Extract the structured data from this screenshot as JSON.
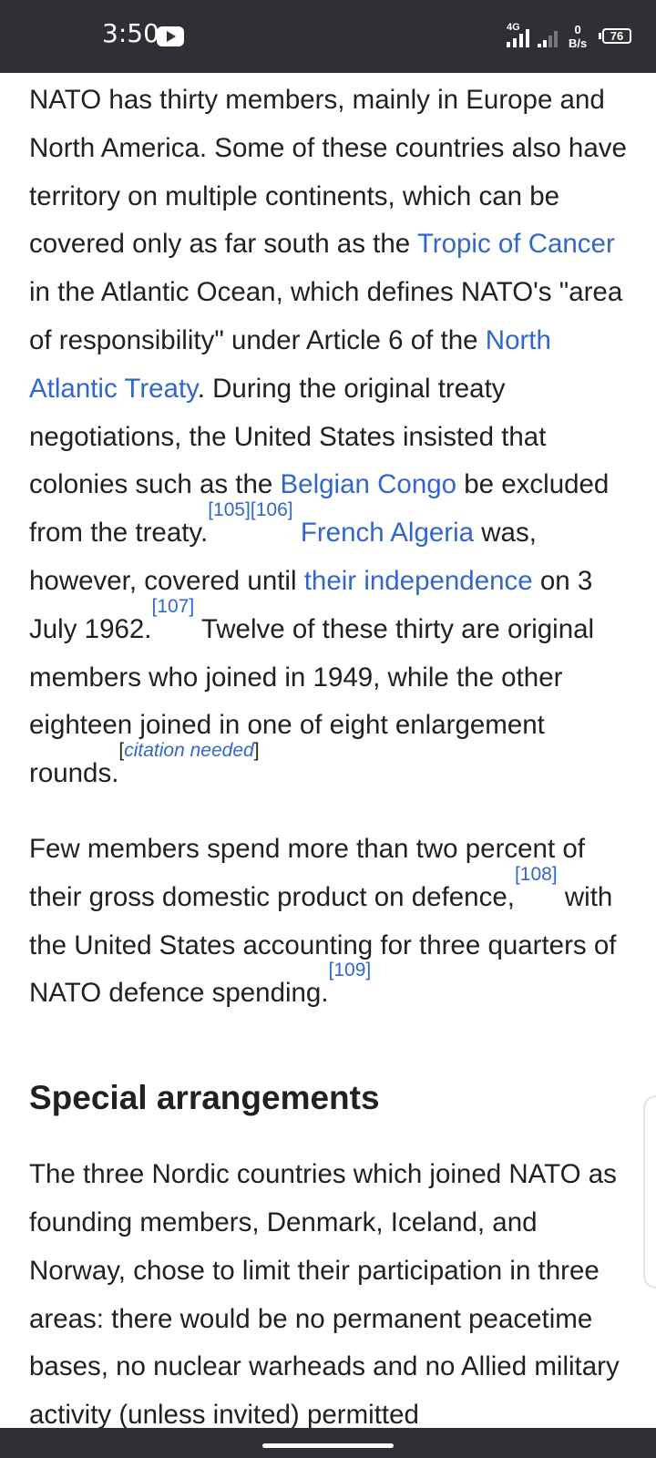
{
  "status_bar": {
    "time": "3:50",
    "network": "4G",
    "speed_value": "0",
    "speed_unit": "B/s",
    "battery": "76"
  },
  "article": {
    "p1": {
      "t1": "NATO has thirty members, mainly in Europe and North America. Some of these countries also have territory on multiple continents, which can be covered only as far south as the ",
      "link_tropic": "Tropic of Cancer",
      "t2": " in the Atlantic Ocean, which defines NATO's \"area of responsibility\" under Article 6 of the ",
      "link_treaty": "North Atlantic Treaty",
      "t3": ". During the original treaty negotiations, the United States insisted that colonies such as the ",
      "link_congo": "Belgian Congo",
      "t4": " be excluded from the treaty.",
      "ref_105": "[105]",
      "ref_106": "[106]",
      "t5": " ",
      "link_algeria": "French Algeria",
      "t6": " was, however, covered until ",
      "link_independence": "their independence",
      "t7": " on 3 July 1962.",
      "ref_107": "[107]",
      "t8": " Twelve of these thirty are original members who joined in 1949, while the other eighteen joined in one of eight enlargement rounds.",
      "cite_open": "[",
      "cite_text": "citation needed",
      "cite_close": "]"
    },
    "p2": {
      "t1": "Few members spend more than two percent of their gross domestic product on defence,",
      "ref_108": "[108]",
      "t2": " with the United States accounting for three quarters of NATO defence spending.",
      "ref_109": "[109]"
    },
    "heading": "Special arrangements",
    "p3": {
      "t1": "The three Nordic countries which joined NATO as founding members, Denmark, Iceland, and Norway, chose to limit their participation in three areas: there would be no permanent peacetime bases, no nuclear warheads and no Allied military activity (unless invited) permitted"
    }
  },
  "colors": {
    "link": "#3366cc",
    "text": "#202122",
    "status_bar": "#2f3033"
  }
}
